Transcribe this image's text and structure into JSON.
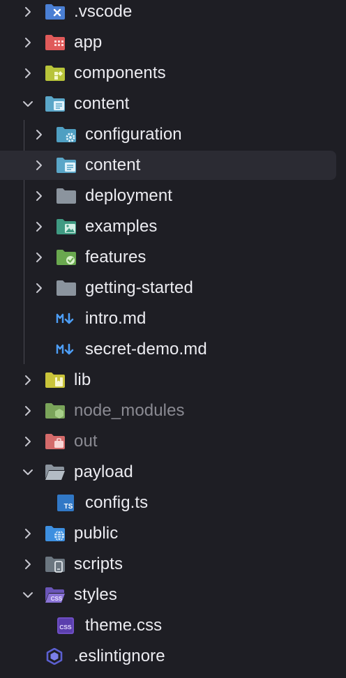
{
  "explorer": {
    "items": [
      {
        "label": ".vscode",
        "state": "collapsed",
        "icon": "vscode-folder-icon"
      },
      {
        "label": "app",
        "state": "collapsed",
        "icon": "app-folder-icon"
      },
      {
        "label": "components",
        "state": "collapsed",
        "icon": "components-folder-icon"
      },
      {
        "label": "content",
        "state": "expanded",
        "icon": "content-folder-icon"
      },
      {
        "label": "configuration",
        "state": "collapsed",
        "icon": "config-folder-icon"
      },
      {
        "label": "content",
        "state": "collapsed",
        "icon": "content-folder-icon",
        "selected": true
      },
      {
        "label": "deployment",
        "state": "collapsed",
        "icon": "folder-icon"
      },
      {
        "label": "examples",
        "state": "collapsed",
        "icon": "images-folder-icon"
      },
      {
        "label": "features",
        "state": "collapsed",
        "icon": "features-folder-icon"
      },
      {
        "label": "getting-started",
        "state": "collapsed",
        "icon": "folder-icon"
      },
      {
        "label": "intro.md",
        "state": "file",
        "icon": "markdown-icon"
      },
      {
        "label": "secret-demo.md",
        "state": "file",
        "icon": "markdown-icon"
      },
      {
        "label": "lib",
        "state": "collapsed",
        "icon": "lib-folder-icon"
      },
      {
        "label": "node_modules",
        "state": "collapsed",
        "icon": "node-folder-icon",
        "dimmed": true
      },
      {
        "label": "out",
        "state": "collapsed",
        "icon": "out-folder-icon",
        "dimmed": true
      },
      {
        "label": "payload",
        "state": "expanded",
        "icon": "open-folder-icon"
      },
      {
        "label": "config.ts",
        "state": "file",
        "icon": "typescript-icon"
      },
      {
        "label": "public",
        "state": "collapsed",
        "icon": "public-folder-icon"
      },
      {
        "label": "scripts",
        "state": "collapsed",
        "icon": "scripts-folder-icon"
      },
      {
        "label": "styles",
        "state": "expanded",
        "icon": "css-folder-icon"
      },
      {
        "label": "theme.css",
        "state": "file",
        "icon": "css-file-icon"
      },
      {
        "label": ".eslintignore",
        "state": "file",
        "icon": "eslint-icon"
      }
    ]
  },
  "colors": {
    "background": "#1e1e24",
    "selected_row": "#2b2b33",
    "text": "#ececf1",
    "dimmed_text": "#8a8a92",
    "chevron": "#c8c8d0",
    "indent_guide": "#4a4a52"
  }
}
